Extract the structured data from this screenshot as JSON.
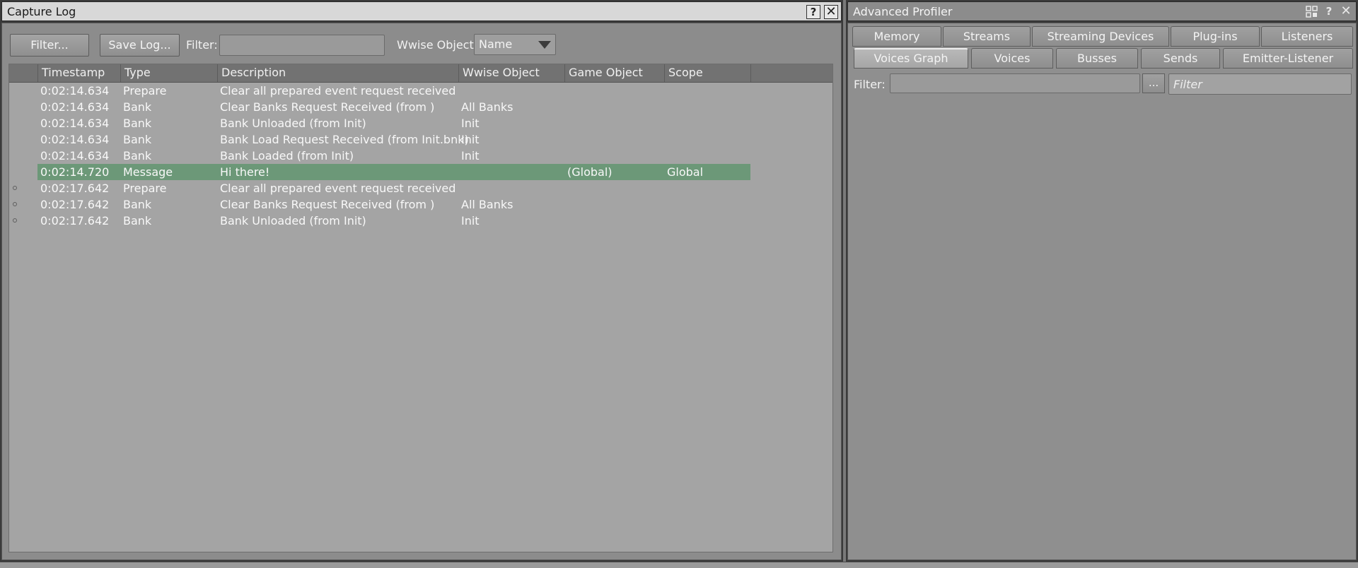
{
  "capture_log": {
    "title": "Capture Log",
    "help_label": "?",
    "close_label": "✕",
    "toolbar": {
      "filter_button": "Filter...",
      "save_log_button": "Save Log...",
      "filter_label": "Filter:",
      "filter_value": "",
      "wwise_object_label": "Wwise Object:",
      "wwise_object_selected": "Name"
    },
    "columns": [
      "Timestamp",
      "Type",
      "Description",
      "Wwise Object",
      "Game Object",
      "Scope"
    ],
    "rows": [
      {
        "timestamp": "0:02:14.634",
        "type": "Prepare",
        "description": "Clear all prepared event request received",
        "wwise_object": "",
        "game_object": "",
        "scope": "",
        "marker": false,
        "highlight": false
      },
      {
        "timestamp": "0:02:14.634",
        "type": "Bank",
        "description": "Clear Banks Request Received (from )",
        "wwise_object": "All Banks",
        "game_object": "",
        "scope": "",
        "marker": false,
        "highlight": false
      },
      {
        "timestamp": "0:02:14.634",
        "type": "Bank",
        "description": "Bank Unloaded (from Init)",
        "wwise_object": "Init",
        "game_object": "",
        "scope": "",
        "marker": false,
        "highlight": false
      },
      {
        "timestamp": "0:02:14.634",
        "type": "Bank",
        "description": "Bank Load Request Received (from Init.bnk)",
        "wwise_object": "Init",
        "game_object": "",
        "scope": "",
        "marker": false,
        "highlight": false
      },
      {
        "timestamp": "0:02:14.634",
        "type": "Bank",
        "description": "Bank Loaded (from Init)",
        "wwise_object": "Init",
        "game_object": "",
        "scope": "",
        "marker": false,
        "highlight": false
      },
      {
        "timestamp": "0:02:14.720",
        "type": "Message",
        "description": "Hi there!",
        "wwise_object": "",
        "game_object": "(Global)",
        "scope": "Global",
        "marker": false,
        "highlight": true
      },
      {
        "timestamp": "0:02:17.642",
        "type": "Prepare",
        "description": "Clear all prepared event request received",
        "wwise_object": "",
        "game_object": "",
        "scope": "",
        "marker": true,
        "highlight": false
      },
      {
        "timestamp": "0:02:17.642",
        "type": "Bank",
        "description": "Clear Banks Request Received (from )",
        "wwise_object": "All Banks",
        "game_object": "",
        "scope": "",
        "marker": true,
        "highlight": false
      },
      {
        "timestamp": "0:02:17.642",
        "type": "Bank",
        "description": "Bank Unloaded (from Init)",
        "wwise_object": "Init",
        "game_object": "",
        "scope": "",
        "marker": true,
        "highlight": false
      }
    ],
    "colors": {
      "highlight_row": "#6c9878"
    }
  },
  "advanced_profiler": {
    "title": "Advanced Profiler",
    "help_label": "?",
    "close_label": "✕",
    "tabs_row1": [
      "Memory",
      "Streams",
      "Streaming Devices",
      "Plug-ins",
      "Listeners"
    ],
    "tabs_row2": [
      "Voices Graph",
      "Voices",
      "Busses",
      "Sends",
      "Emitter-Listener"
    ],
    "active_tab": "Voices Graph",
    "filter_label": "Filter:",
    "filter_value": "",
    "browse_button": "...",
    "filter_placeholder": "Filter"
  }
}
